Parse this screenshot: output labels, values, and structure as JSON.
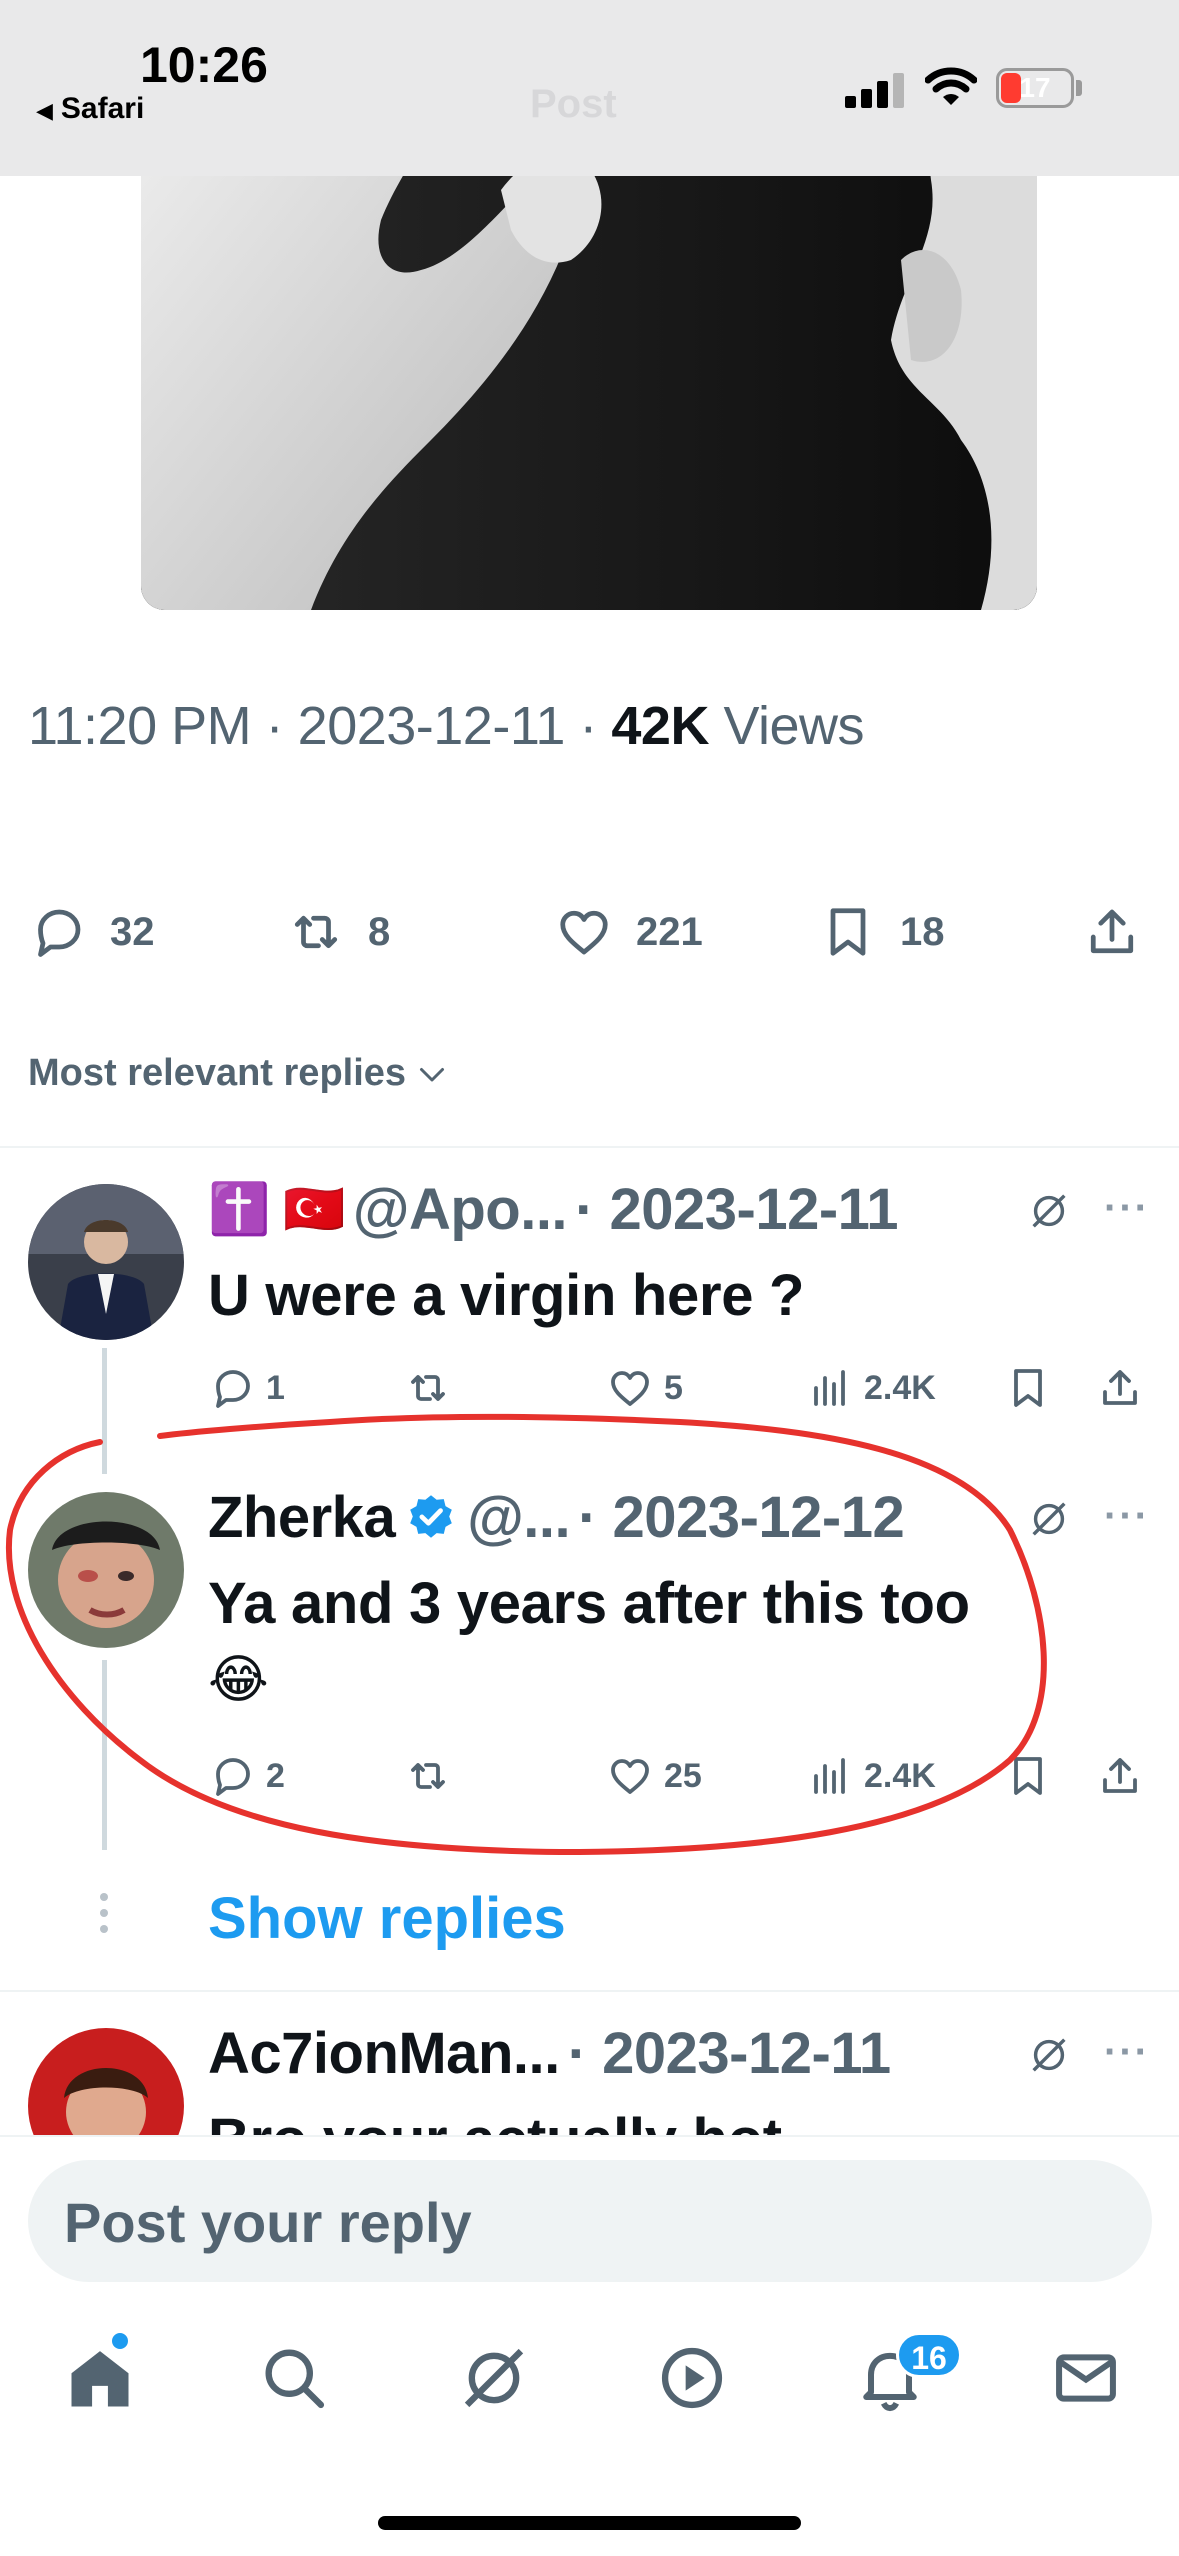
{
  "status_bar": {
    "time": "10:26",
    "back_label": "Safari",
    "battery": "17",
    "ghost_title": "Post"
  },
  "post": {
    "meta_time": "11:20 PM",
    "meta_date": "2023-12-11",
    "views_count": "42K",
    "views_label": "Views",
    "separator": "·",
    "actions": {
      "replies": "32",
      "reposts": "8",
      "likes": "221",
      "bookmarks": "18"
    }
  },
  "sort_label": "Most relevant replies",
  "replies": [
    {
      "badges": "✝️ 🇹🇷",
      "handle": "@Apo...",
      "date": "· 2023-12-11",
      "text": "U were a virgin here ?",
      "replies": "1",
      "reposts": "",
      "likes": "5",
      "views": "2.4K"
    },
    {
      "name": "Zherka",
      "handle": "@...",
      "date": "· 2023-12-12",
      "text_line1": "Ya and 3 years after this too",
      "text_line2": "😂",
      "replies": "2",
      "reposts": "",
      "likes": "25",
      "views": "2.4K"
    },
    {
      "name": "Ac7ionMan...",
      "date": "· 2023-12-11",
      "text": "Bro your actually hot"
    }
  ],
  "show_replies_label": "Show replies",
  "composer": {
    "placeholder": "Post your reply"
  },
  "nav": {
    "items": [
      "home-icon",
      "search-icon",
      "grok-icon",
      "play-icon",
      "notifications-icon",
      "messages-icon"
    ],
    "notifications_badge": "16"
  },
  "colors": {
    "accent": "#1d9bf0",
    "secondary_text": "#536471",
    "annotation": "#e6322d"
  }
}
